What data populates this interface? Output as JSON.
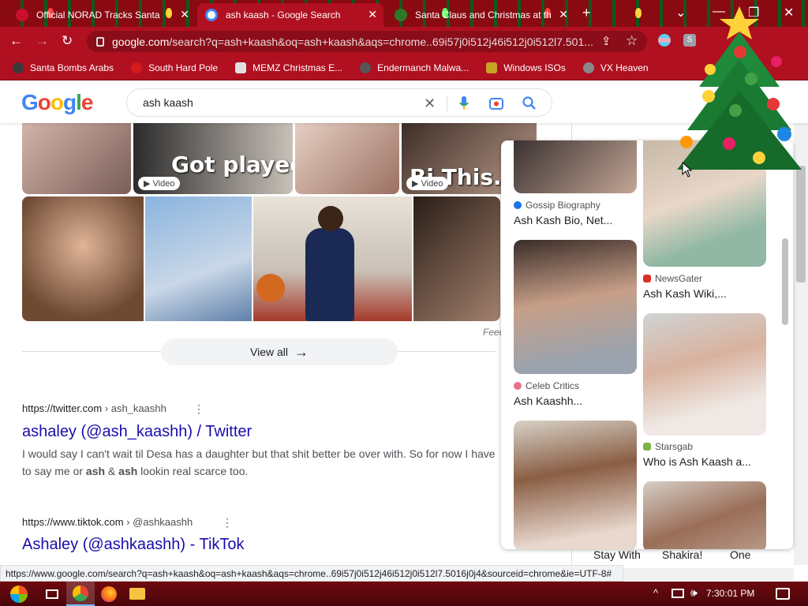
{
  "tabs": [
    {
      "title": "Official NORAD Tracks Santa",
      "close": "✕",
      "active": false,
      "favicon_color": "#c8102e"
    },
    {
      "title": "ash kaash - Google Search",
      "close": "✕",
      "active": true,
      "favicon_color": "#4285f4"
    },
    {
      "title": "Santa Claus and Christmas at th",
      "close": "✕",
      "active": false,
      "favicon_color": "#2a7a2a"
    }
  ],
  "new_tab": "+",
  "window_controls": {
    "menu": "⌄",
    "minimize": "—",
    "maximize": "❐",
    "close": "✕"
  },
  "toolbar": {
    "url_host": "google.com",
    "url_path": "/search?q=ash+kaash&oq=ash+kaash&aqs=chrome..69i57j0i512j46i512j0i512l7.501..."
  },
  "bookmarks": [
    {
      "label": "Santa Bombs Arabs",
      "icon_color": "#3a3a3a"
    },
    {
      "label": "South Hard Pole",
      "icon_color": "#d41a1a"
    },
    {
      "label": "MEMZ Christmas E...",
      "icon_color": "#e0e0e0"
    },
    {
      "label": "Endermanch Malwa...",
      "icon_color": "#555555"
    },
    {
      "label": "Windows ISOs",
      "icon_color": "#c9a227"
    },
    {
      "label": "VX Heaven",
      "icon_color": "#888888"
    }
  ],
  "google": {
    "logo": "Google",
    "query": "ash kaash",
    "video_badge": "▶ Video",
    "overlay_text_1": "Got played..",
    "overlay_text_2": "Bi This..",
    "feedback": "Feed",
    "view_all": "View all",
    "results": [
      {
        "url_base": "https://twitter.com",
        "url_path": " › ash_kaashh",
        "title": "ashaley (@ash_kaashh) / Twitter",
        "snippet_a": "I would say I can't wait til Desa has a daughter but that shit better be over with. So for now I have to say me or ",
        "snippet_b1": "ash",
        "snippet_amp": " & ",
        "snippet_b2": "ash",
        "snippet_c": " lookin real scarce too."
      },
      {
        "url_base": "https://www.tiktok.com",
        "url_path": " › @ashkaashh",
        "title": "Ashaley (@ashkaashh) - TikTok"
      }
    ]
  },
  "image_panel": {
    "items": [
      {
        "source": "Gossip Biography",
        "title": "Ash Kash Bio, Net...",
        "source_color": "#1a73e8"
      },
      {
        "source": "NewsGater",
        "title": "Ash Kash Wiki,...",
        "source_color": "#d93025"
      },
      {
        "source": "Celeb Critics",
        "title": "Ash Kaashh...",
        "source_color": "#e8718a"
      },
      {
        "source": "Starsgab",
        "title": "Who is Ash Kaash a...",
        "source_color": "#7cb342"
      }
    ]
  },
  "suggestions": [
    "Stay With",
    "Shakira!",
    "One"
  ],
  "statusbar": "https://www.google.com/search?q=ash+kaash&oq=ash+kaash&aqs=chrome..69i57j0i512j46i512j0i512l7.5016j0j4&sourceid=chrome&ie=UTF-8#",
  "taskbar": {
    "clock": "7:30:01 PM"
  }
}
